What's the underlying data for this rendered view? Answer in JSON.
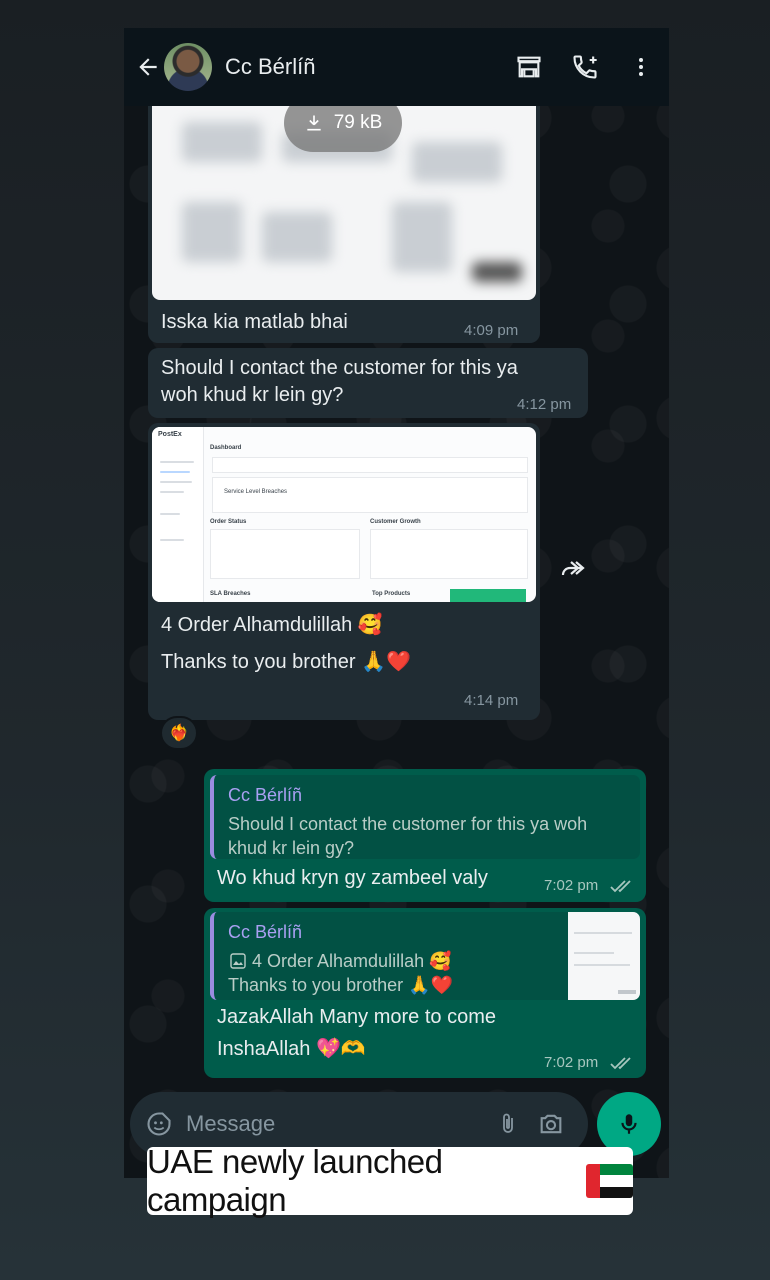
{
  "header": {
    "contact_name": "Cc Bérlíñ",
    "icons": [
      "back-arrow-icon",
      "shop-icon",
      "add-call-icon",
      "more-vertical-icon"
    ]
  },
  "messages": [
    {
      "direction": "incoming",
      "attachment": "blurred-image",
      "download_size": "79 kB",
      "text": "Isska kia matlab bhai",
      "time": "4:09 pm"
    },
    {
      "direction": "incoming",
      "text_line1": "Should I contact the customer for this ya",
      "text_line2": "woh khud kr lein gy?",
      "time": "4:12 pm"
    },
    {
      "direction": "incoming",
      "attachment": "dashboard-screenshot",
      "dashboard": {
        "brand": "PostEx",
        "page": "Dashboard",
        "card_label": "Service Level Breaches",
        "order_status": "Order Status",
        "customer_growth": "Customer Growth",
        "sla_breaches": "SLA Breaches",
        "top_products": "Top Products"
      },
      "text_line1": "4 Order Alhamdulillah 🥰",
      "text_line2": "Thanks to you brother 🙏❤️",
      "time": "4:14 pm",
      "reaction": "❤️‍🔥"
    },
    {
      "direction": "outgoing",
      "quote_name": "Cc Bérlíñ",
      "quote_line1": "Should I contact the customer for this ya woh",
      "quote_line2": "khud kr lein gy?",
      "text": "Wo khud kryn gy zambeel valy",
      "time": "7:02 pm",
      "status": "read"
    },
    {
      "direction": "outgoing",
      "quote_name": "Cc Bérlíñ",
      "quote_line1": "4 Order Alhamdulillah 🥰",
      "quote_line2": "Thanks to you brother 🙏❤️",
      "text_line1": "JazakAllah Many more to come",
      "text_line2": "InshaAllah 💖🫶",
      "time": "7:02 pm",
      "status": "read"
    }
  ],
  "composer": {
    "placeholder": "Message"
  },
  "caption": {
    "text": "UAE newly launched campaign",
    "flag": "🇦🇪"
  }
}
